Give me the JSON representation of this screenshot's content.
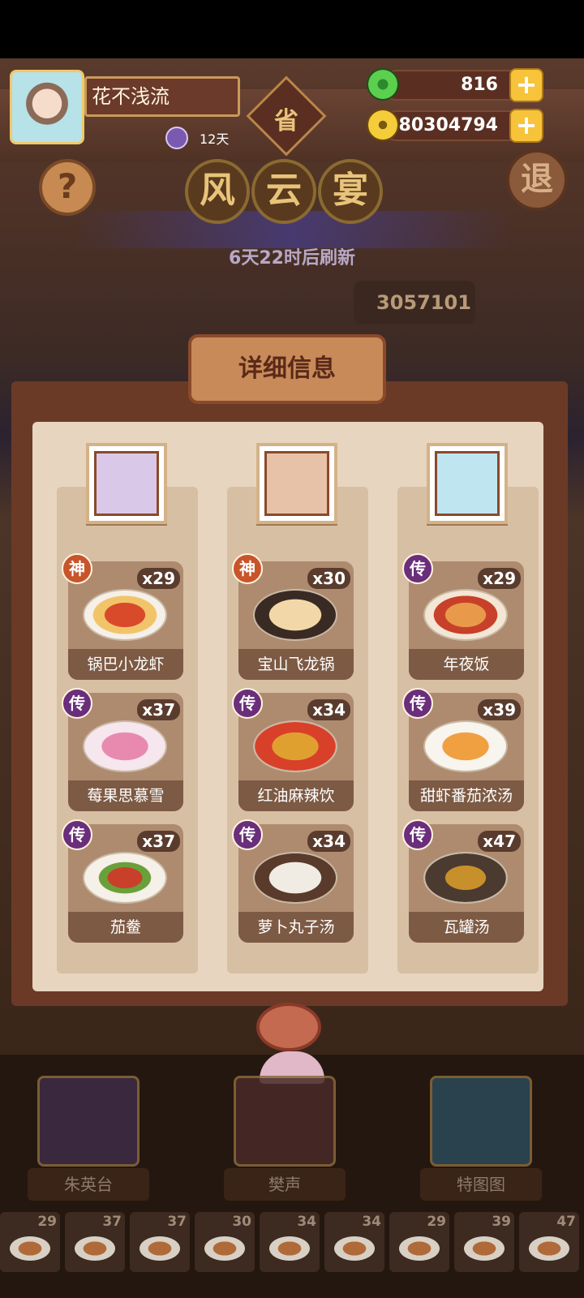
{
  "player": {
    "name": "花不浅流",
    "days": "12天"
  },
  "currency": {
    "jade": "816",
    "coins": "80304794"
  },
  "title": {
    "badge": "省",
    "chars": [
      "风",
      "云",
      "宴"
    ]
  },
  "buttons": {
    "help": "?",
    "exit": "退",
    "plus": "+"
  },
  "refresh_text": "6天22时后刷新",
  "score": "3057101",
  "detail_tab": "详细信息",
  "columns": [
    {
      "dishes": [
        {
          "name": "锅巴小龙虾",
          "count": "x29",
          "grade": "神"
        },
        {
          "name": "莓果思慕雪",
          "count": "x37",
          "grade": "传"
        },
        {
          "name": "茄鲞",
          "count": "x37",
          "grade": "传"
        }
      ]
    },
    {
      "dishes": [
        {
          "name": "宝山飞龙锅",
          "count": "x30",
          "grade": "神"
        },
        {
          "name": "红油麻辣饮",
          "count": "x34",
          "grade": "传"
        },
        {
          "name": "萝卜丸子汤",
          "count": "x34",
          "grade": "传"
        }
      ]
    },
    {
      "dishes": [
        {
          "name": "年夜饭",
          "count": "x29",
          "grade": "传"
        },
        {
          "name": "甜虾番茄浓汤",
          "count": "x39",
          "grade": "传"
        },
        {
          "name": "瓦罐汤",
          "count": "x47",
          "grade": "传"
        }
      ]
    }
  ],
  "chefs": [
    "朱英台",
    "樊声",
    "特图图"
  ],
  "bottom_dishes": [
    "29",
    "37",
    "37",
    "30",
    "34",
    "34",
    "29",
    "39",
    "47"
  ]
}
